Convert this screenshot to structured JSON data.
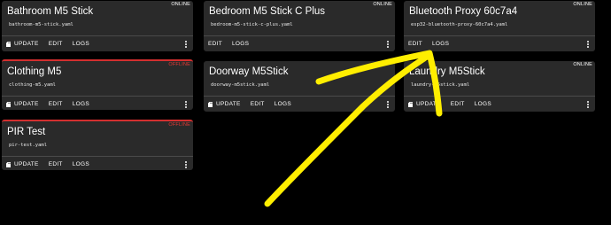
{
  "devices": [
    {
      "name": "Bathroom M5 Stick",
      "file": "bathroom-m5-stick.yaml",
      "status": "ONLINE",
      "show_update": true
    },
    {
      "name": "Bedroom M5 Stick C Plus",
      "file": "bedroom-m5-stick-c-plus.yaml",
      "status": "ONLINE",
      "show_update": false
    },
    {
      "name": "Bluetooth Proxy 60c7a4",
      "file": "esp32-bluetooth-proxy-60c7a4.yaml",
      "status": "ONLINE",
      "show_update": false
    },
    {
      "name": "Clothing M5",
      "file": "clothing-m5.yaml",
      "status": "OFFLINE",
      "show_update": true
    },
    {
      "name": "Doorway M5Stick",
      "file": "doorway-m5stick.yaml",
      "status": "",
      "show_update": true
    },
    {
      "name": "Laundry M5Stick",
      "file": "laundry-m5stick.yaml",
      "status": "ONLINE",
      "show_update": true
    },
    {
      "name": "PIR Test",
      "file": "pir-test.yaml",
      "status": "OFFLINE",
      "show_update": true
    }
  ],
  "actions": {
    "update": "UPDATE",
    "edit": "EDIT",
    "logs": "LOGS"
  },
  "icons": {
    "update": "sd-card-icon",
    "more": "more-vert-icon"
  },
  "colors": {
    "card": "#2a2a2a",
    "offline": "#d32f2f",
    "annotation": "#ffee00"
  }
}
